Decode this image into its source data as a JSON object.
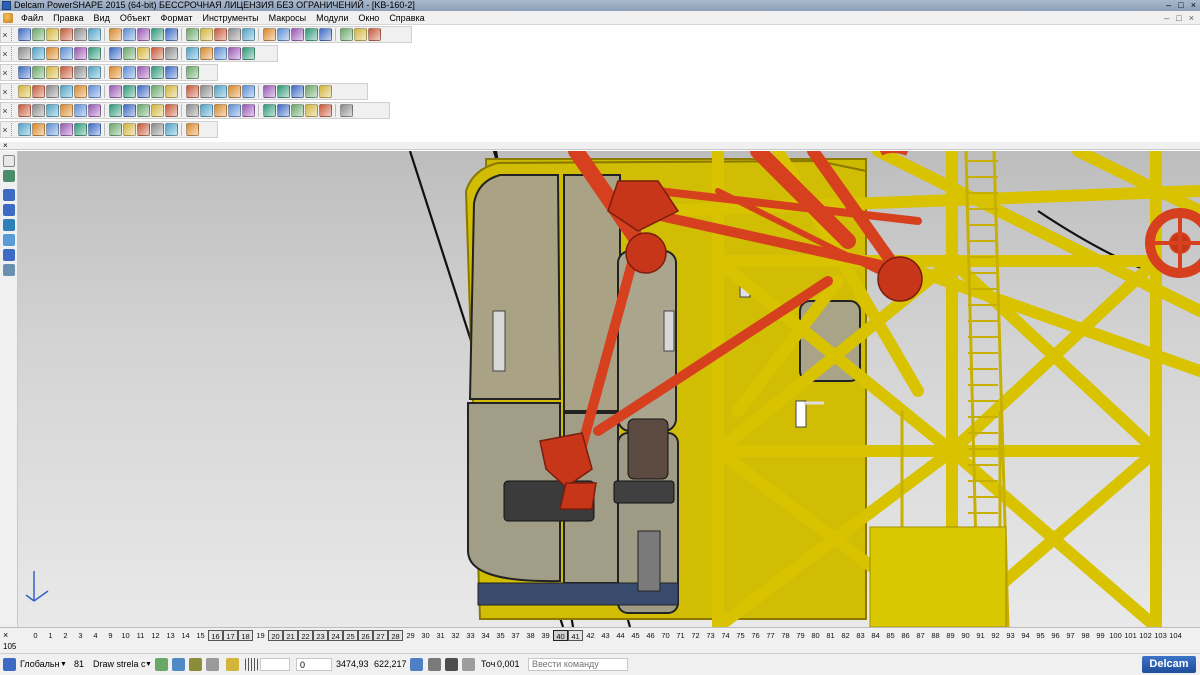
{
  "window": {
    "title": "Delcam PowerSHAPE 2015 (64-bit) БЕССРОЧНАЯ ЛИЦЕНЗИЯ БЕЗ ОГРАНИЧЕНИЙ - [KB-160-2]",
    "controls": [
      "–",
      "□",
      "×"
    ]
  },
  "menu": {
    "items": [
      "Файл",
      "Правка",
      "Вид",
      "Объект",
      "Формат",
      "Инструменты",
      "Макросы",
      "Модули",
      "Окно",
      "Справка"
    ],
    "mdi_controls": [
      "–",
      "□",
      "×"
    ]
  },
  "toolbars": {
    "close_glyph": "×"
  },
  "levels": {
    "first_row": [
      "0",
      "1",
      "2",
      "3",
      "4",
      "9",
      "10",
      "11",
      "12",
      "13",
      "14",
      "15",
      "16",
      "17",
      "18",
      "19",
      "20",
      "21",
      "22",
      "23",
      "24",
      "25",
      "26",
      "27",
      "28",
      "29",
      "30",
      "31",
      "32",
      "33",
      "34",
      "35",
      "37",
      "38",
      "39",
      "40",
      "41",
      "42",
      "43",
      "44",
      "45",
      "46",
      "70",
      "71",
      "72",
      "73",
      "74",
      "75",
      "76",
      "77",
      "78",
      "79",
      "80",
      "81",
      "82",
      "83",
      "84",
      "85",
      "86",
      "87",
      "88",
      "89",
      "90",
      "91",
      "92",
      "93",
      "94",
      "95",
      "96",
      "97",
      "98",
      "99",
      "100",
      "101",
      "102",
      "103",
      "104"
    ],
    "second_row": "105",
    "selected": "40"
  },
  "status": {
    "workplane": "Глобальн",
    "level_number": "81",
    "level_name": "Draw strela c",
    "field_value": "0",
    "x_coord": "3474,93",
    "y_coord": "622,217",
    "tolerance_label": "Точ",
    "tolerance_value": "0,001",
    "command_placeholder": "Ввести команду",
    "logo": "Delcam"
  },
  "colors": {
    "yellow": "#d9c300",
    "red": "#d6401f",
    "cabin": "#c8b400"
  }
}
